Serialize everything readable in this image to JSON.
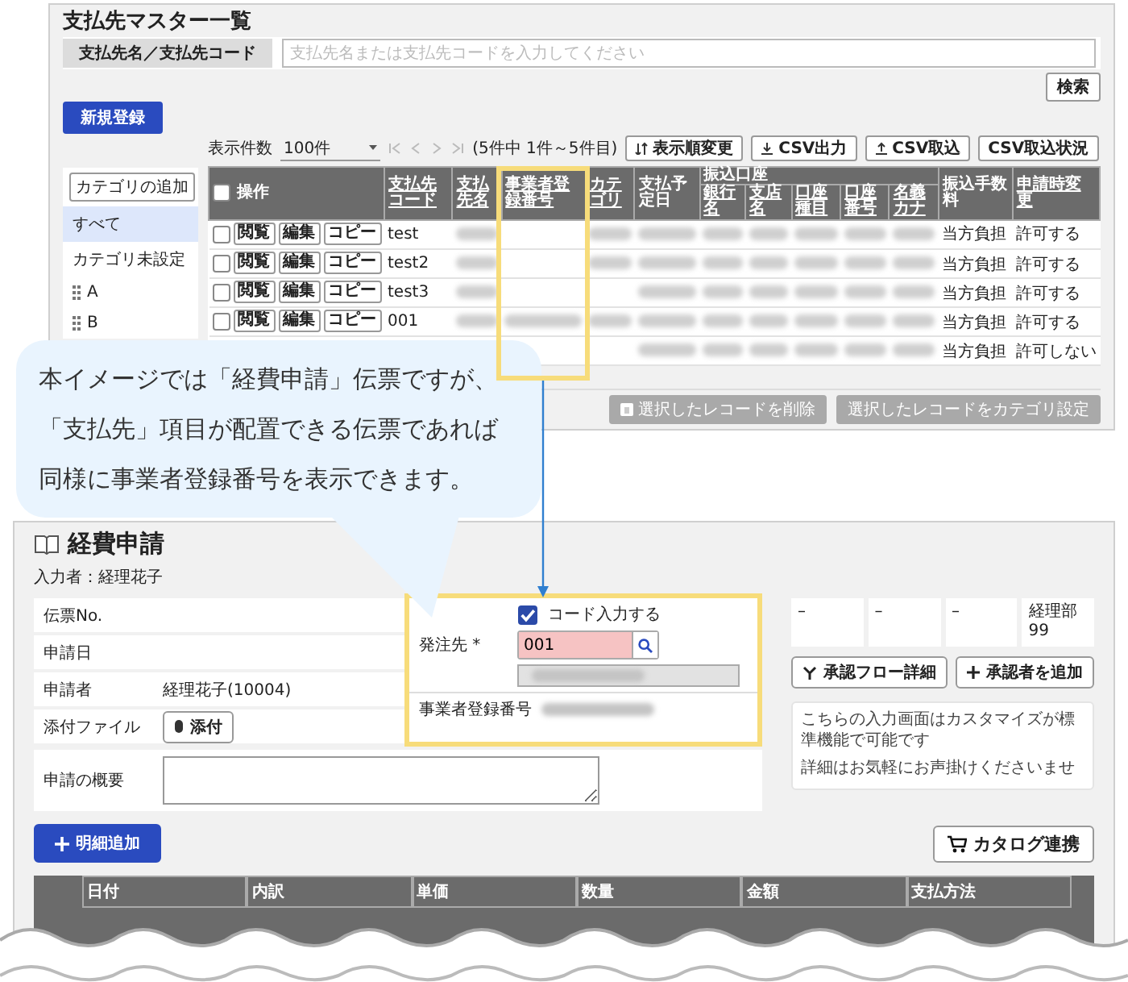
{
  "master": {
    "title": "支払先マスター一覧",
    "search_label": "支払先名／支払先コード",
    "search_placeholder": "支払先名または支払先コードを入力してください",
    "search_button": "検索",
    "new_button": "新規登録",
    "toolbar": {
      "count_label": "表示件数",
      "count_value": "100件",
      "range": "(5件中 1件～5件目)",
      "buttons": [
        {
          "label": "表示順変更"
        },
        {
          "label": "CSV出力"
        },
        {
          "label": "CSV取込"
        },
        {
          "label": "CSV取込状況"
        }
      ]
    },
    "sidebar": {
      "add_button": "カテゴリの追加",
      "items": [
        {
          "label": "すべて",
          "selected": true,
          "kind": "plain"
        },
        {
          "label": "カテゴリ未設定",
          "selected": false,
          "kind": "plain"
        },
        {
          "label": "A",
          "selected": false,
          "kind": "category"
        },
        {
          "label": "B",
          "selected": false,
          "kind": "category"
        }
      ]
    },
    "table": {
      "columns": [
        {
          "label": "操作",
          "kind": "select",
          "checked": false
        },
        {
          "label": "支払先コード",
          "sortable": true
        },
        {
          "label": "支払先名",
          "sortable": true
        },
        {
          "label": "事業者登録番号",
          "sortable": true,
          "highlighted": true
        },
        {
          "label": "カテゴリ",
          "sortable": true
        },
        {
          "label": "支払予定日",
          "sortable": false
        },
        {
          "label": "振込口座",
          "children": [
            {
              "label": "銀行名",
              "sortable": true
            },
            {
              "label": "支店名",
              "sortable": true
            },
            {
              "label": "口座種目",
              "sortable": true
            },
            {
              "label": "口座番号",
              "sortable": true
            },
            {
              "label": "名義カナ",
              "sortable": true
            }
          ]
        },
        {
          "label": "振込手数料",
          "sortable": false
        },
        {
          "label": "申請時変更",
          "sortable": true
        }
      ],
      "rows": [
        {
          "checked": false,
          "actions": [
            "閲覧",
            "編集",
            "コピー"
          ],
          "cells": [
            {
              "kind": "text",
              "text": "test"
            },
            {
              "kind": "redacted"
            },
            {
              "kind": "empty"
            },
            {
              "kind": "redacted"
            },
            {
              "kind": "redacted"
            },
            {
              "kind": "redacted"
            },
            {
              "kind": "redacted"
            },
            {
              "kind": "redacted"
            },
            {
              "kind": "redacted"
            },
            {
              "kind": "redacted"
            },
            {
              "kind": "text",
              "text": "当方負担"
            },
            {
              "kind": "text",
              "text": "許可する"
            }
          ]
        },
        {
          "checked": false,
          "actions": [
            "閲覧",
            "編集",
            "コピー"
          ],
          "cells": [
            {
              "kind": "text",
              "text": "test2"
            },
            {
              "kind": "redacted"
            },
            {
              "kind": "empty"
            },
            {
              "kind": "redacted"
            },
            {
              "kind": "redacted"
            },
            {
              "kind": "redacted"
            },
            {
              "kind": "redacted"
            },
            {
              "kind": "redacted"
            },
            {
              "kind": "redacted"
            },
            {
              "kind": "redacted"
            },
            {
              "kind": "text",
              "text": "当方負担"
            },
            {
              "kind": "text",
              "text": "許可する"
            }
          ]
        },
        {
          "checked": false,
          "actions": [
            "閲覧",
            "編集",
            "コピー"
          ],
          "cells": [
            {
              "kind": "text",
              "text": "test3"
            },
            {
              "kind": "redacted"
            },
            {
              "kind": "empty"
            },
            {
              "kind": "empty"
            },
            {
              "kind": "redacted"
            },
            {
              "kind": "redacted"
            },
            {
              "kind": "redacted"
            },
            {
              "kind": "redacted"
            },
            {
              "kind": "redacted"
            },
            {
              "kind": "redacted"
            },
            {
              "kind": "text",
              "text": "当方負担"
            },
            {
              "kind": "text",
              "text": "許可する"
            }
          ]
        },
        {
          "checked": false,
          "actions": [
            "閲覧",
            "編集",
            "コピー"
          ],
          "cells": [
            {
              "kind": "text",
              "text": "001"
            },
            {
              "kind": "redacted"
            },
            {
              "kind": "redacted"
            },
            {
              "kind": "redacted"
            },
            {
              "kind": "redacted"
            },
            {
              "kind": "redacted"
            },
            {
              "kind": "redacted"
            },
            {
              "kind": "redacted"
            },
            {
              "kind": "redacted"
            },
            {
              "kind": "redacted"
            },
            {
              "kind": "text",
              "text": "当方負担"
            },
            {
              "kind": "text",
              "text": "許可する"
            }
          ]
        },
        {
          "cells": [
            {
              "kind": "empty"
            },
            {
              "kind": "empty"
            },
            {
              "kind": "empty"
            },
            {
              "kind": "empty"
            },
            {
              "kind": "redacted"
            },
            {
              "kind": "redacted"
            },
            {
              "kind": "redacted"
            },
            {
              "kind": "redacted"
            },
            {
              "kind": "redacted"
            },
            {
              "kind": "redacted"
            },
            {
              "kind": "text",
              "text": "当方負担"
            },
            {
              "kind": "text",
              "text": "許可しない"
            }
          ]
        }
      ]
    },
    "bottom_buttons": [
      {
        "label": "選択したレコードを削除",
        "disabled": true
      },
      {
        "label": "選択したレコードをカテゴリ設定",
        "disabled": true
      }
    ]
  },
  "callout": {
    "lines": [
      "本イメージでは「経費申請」伝票ですが、",
      "「支払先」項目が配置できる伝票であれば",
      "同様に事業者登録番号を表示できます。"
    ]
  },
  "form": {
    "title": "経費申請",
    "entered_by": "入力者：経理花子",
    "fields": [
      {
        "label": "伝票No.",
        "kind": "plain"
      },
      {
        "label": "申請日",
        "kind": "plain"
      },
      {
        "label": "申請者",
        "kind": "plain",
        "value": "経理花子(10004)"
      },
      {
        "label": "添付ファイル",
        "kind": "attach",
        "button": "添付"
      }
    ],
    "summary": {
      "label": "申請の概要"
    },
    "vendor": {
      "highlighted": true,
      "code_input": {
        "label": "コード入力する",
        "checked": true
      },
      "label": "発注先",
      "required_mark": "*",
      "value": "001",
      "invalid": true,
      "reg_label": "事業者登録番号"
    },
    "approval": {
      "cells": [
        [
          "–"
        ],
        [
          "–"
        ],
        [
          "–"
        ],
        [
          "経理部",
          "99"
        ]
      ],
      "flow_button": "承認フロー詳細",
      "add_button": "承認者を追加"
    },
    "notes": [
      "こちらの入力画面はカスタマイズが標準機能で可能です",
      "詳細はお気軽にお声掛けくださいませ"
    ],
    "add_line_button": "明細追加",
    "catalog_button": "カタログ連携",
    "lines_table": {
      "columns": [
        "日付",
        "内訳",
        "単価",
        "数量",
        "金額",
        "支払方法"
      ]
    }
  }
}
